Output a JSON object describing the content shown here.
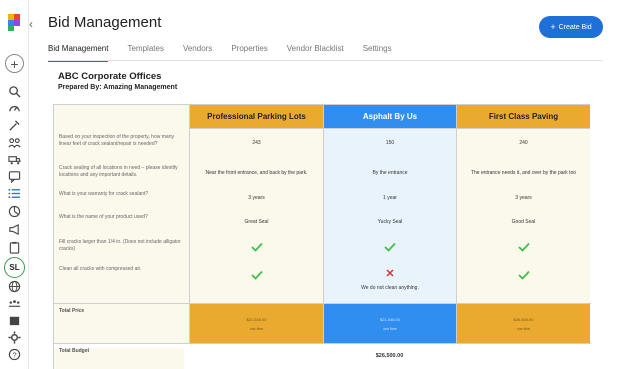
{
  "header": {
    "title": "Bid Management",
    "create_label": "Create Bid"
  },
  "tabs": [
    {
      "label": "Bid Management"
    },
    {
      "label": "Templates"
    },
    {
      "label": "Vendors"
    },
    {
      "label": "Properties"
    },
    {
      "label": "Vendor Blacklist"
    },
    {
      "label": "Settings"
    }
  ],
  "bid": {
    "company": "ABC Corporate Offices",
    "prepared_by": "Prepared By: Amazing Management"
  },
  "questions": [
    "Based on your inspection of the property, how many linear feet of crack sealant/repair is needed?",
    "Crack sealing of all locations in need – please identify locations and any important details.",
    "What is your warranty for crack sealant?",
    "What is the name of your product used?",
    "Fill cracks larger than 1/4 in. (Does not include alligator cracks)",
    "Clean all cracks with compressed air."
  ],
  "vendors": [
    {
      "name": "Professional Parking Lots",
      "answers": [
        "243",
        "Near the front entrance, and back by the park.",
        "3 years",
        "Great Seal"
      ],
      "fill_cracks": true,
      "clean_cracks": true,
      "clean_note": "",
      "price": "$21,546.00",
      "price_sub": "one time"
    },
    {
      "name": "Asphalt By Us",
      "answers": [
        "150",
        "By the entrance",
        "1 year",
        "Yucky Seal"
      ],
      "fill_cracks": true,
      "clean_cracks": false,
      "clean_note": "We do not clean anything.",
      "price": "$21,546.00",
      "price_sub": "one time"
    },
    {
      "name": "First Class Paving",
      "answers": [
        "240",
        "The entrance needs it, and over by the park too",
        "3 years",
        "Good Seal"
      ],
      "fill_cracks": true,
      "clean_cracks": true,
      "clean_note": "",
      "price": "$26,450.00",
      "price_sub": "one time"
    }
  ],
  "totals": {
    "price_label": "Total Price",
    "budget_label": "Total Budget",
    "budget_value": "$26,500.00"
  },
  "sidebar": {
    "avatar_initials": "SL"
  },
  "colors": {
    "accent": "#1e6fd8",
    "orange": "#e9aa2f",
    "blue": "#2f8ef0",
    "check": "#3fbf4a",
    "x": "#d9342b"
  }
}
